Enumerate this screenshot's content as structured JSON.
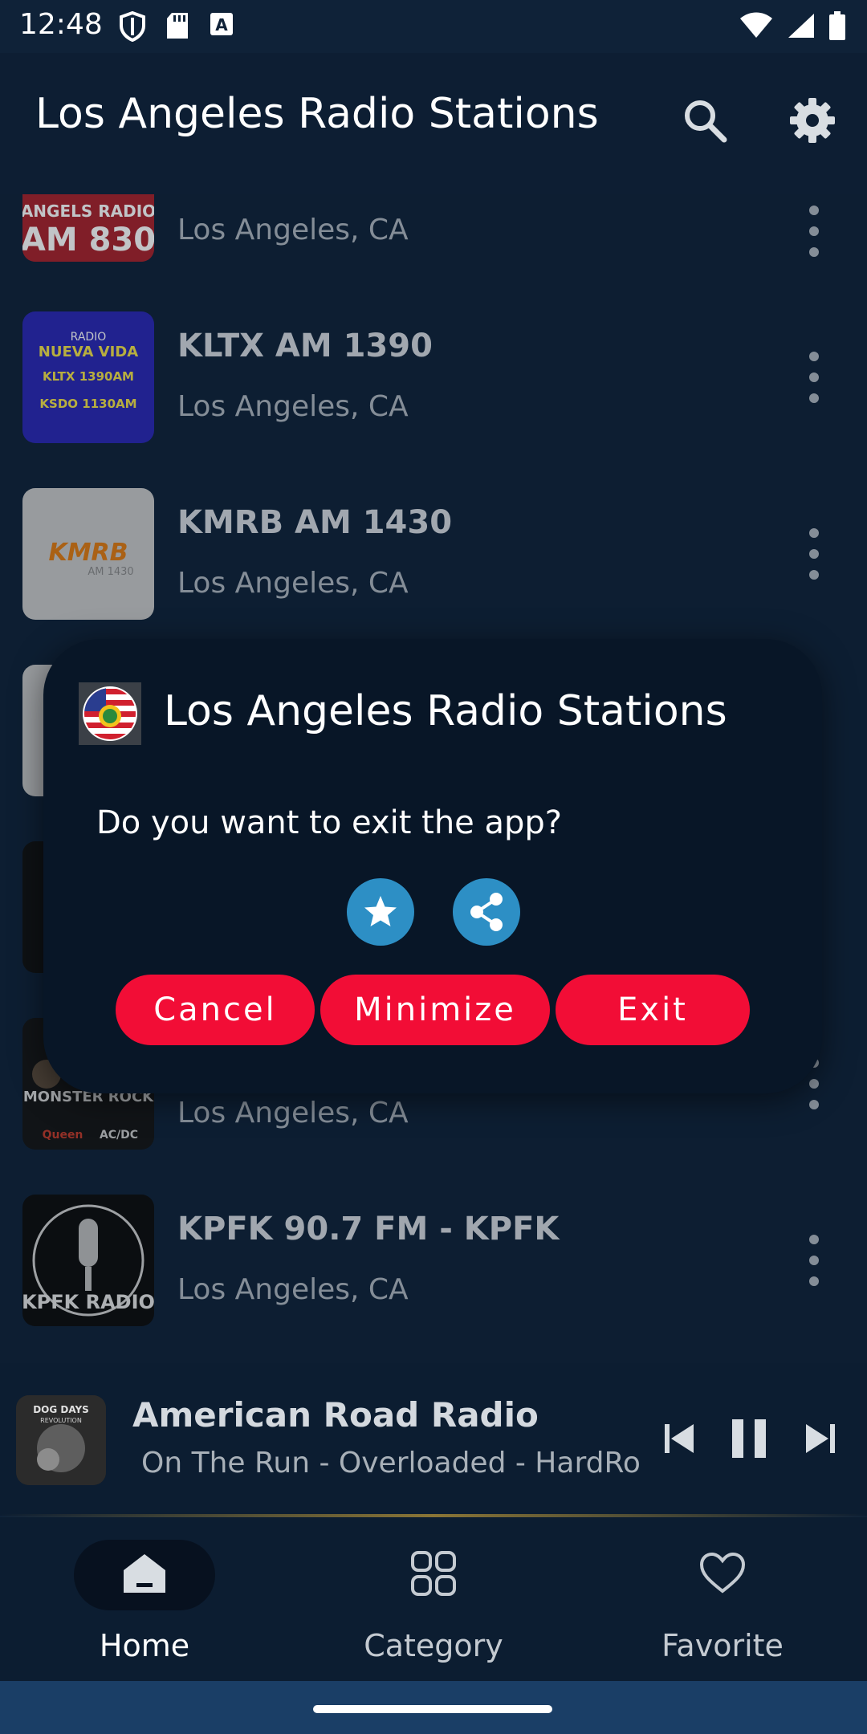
{
  "status_bar": {
    "time": "12:48",
    "icons_left": [
      "shield-icon",
      "sd-card-icon",
      "keyboard-a-icon"
    ],
    "icons_right": [
      "wifi-icon",
      "signal-icon",
      "battery-icon"
    ]
  },
  "app_bar": {
    "title": "Los Angeles Radio Stations",
    "actions": [
      "search-icon",
      "settings-icon"
    ]
  },
  "stations": [
    {
      "name": "",
      "location": "Los Angeles, CA",
      "logo_text": "ANGELS RADIO AM 830"
    },
    {
      "name": "KLTX AM 1390",
      "location": "Los Angeles, CA",
      "logo_text": "RADIO NUEVA VIDA KLTX 1390AM KSDO 1130AM"
    },
    {
      "name": "KMRB AM 1430",
      "location": "Los Angeles, CA",
      "logo_text": "KMRB AM 1430"
    },
    {
      "name": "",
      "location": "",
      "logo_text": ""
    },
    {
      "name": "",
      "location": "",
      "logo_text": ""
    },
    {
      "name": "",
      "location": "Los Angeles, CA",
      "logo_text": "MONSTER ROCK"
    },
    {
      "name": "KPFK 90.7 FM - KPFK",
      "location": "Los Angeles, CA",
      "logo_text": "KPFK RADIO"
    }
  ],
  "dialog": {
    "title": "Los Angeles Radio Stations",
    "message": "Do you want to exit the app?",
    "icon_buttons": [
      "star-icon",
      "share-icon"
    ],
    "buttons": {
      "cancel": "Cancel",
      "minimize": "Minimize",
      "exit": "Exit"
    }
  },
  "mini_player": {
    "title": "American Road Radio",
    "subtitle": "On The Run - Overloaded - HardRock",
    "art_text": "DOG DAYS REVOLUTION",
    "controls": [
      "skip-previous-icon",
      "pause-icon",
      "skip-next-icon"
    ]
  },
  "bottom_nav": {
    "items": [
      {
        "label": "Home",
        "icon": "home-icon",
        "active": true
      },
      {
        "label": "Category",
        "icon": "category-grid-icon",
        "active": false
      },
      {
        "label": "Favorite",
        "icon": "heart-icon",
        "active": false
      }
    ]
  },
  "colors": {
    "background": "#0f2238",
    "dialog_bg": "#081627",
    "accent_red": "#f20d36",
    "accent_blue": "#2d8fc5"
  }
}
